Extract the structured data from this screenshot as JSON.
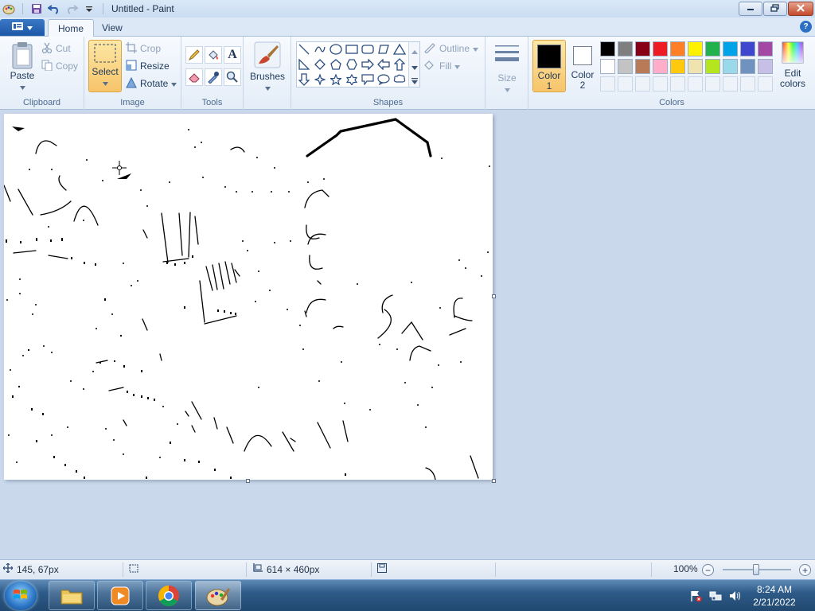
{
  "window": {
    "title": "Untitled - Paint",
    "minimize_icon": "minimize-icon",
    "maximize_icon": "restore-icon",
    "close_icon": "close-icon"
  },
  "qat": {
    "icons": [
      "paint-app-icon",
      "save-icon",
      "undo-icon",
      "redo-icon",
      "customize-dropdown-icon"
    ]
  },
  "tabs": {
    "items": [
      "Home",
      "View"
    ],
    "active": "Home"
  },
  "ribbon": {
    "clipboard": {
      "label": "Clipboard",
      "paste": "Paste",
      "cut": "Cut",
      "copy": "Copy"
    },
    "image": {
      "label": "Image",
      "select": "Select",
      "crop": "Crop",
      "resize": "Resize",
      "rotate": "Rotate"
    },
    "tools": {
      "label": "Tools",
      "items": [
        "pencil-icon",
        "fill-icon",
        "text-icon",
        "eraser-icon",
        "color-picker-icon",
        "magnifier-icon"
      ]
    },
    "brushes": {
      "label": "Brushes"
    },
    "shapes": {
      "label": "Shapes",
      "outline": "Outline",
      "fill": "Fill"
    },
    "size": {
      "label": "Size"
    },
    "colors": {
      "label": "Colors",
      "color1": [
        "Color",
        "1"
      ],
      "color2": [
        "Color",
        "2"
      ],
      "color1_value": "#000000",
      "color2_value": "#ffffff",
      "edit": [
        "Edit",
        "colors"
      ],
      "palette_row1": [
        "#000000",
        "#7f7f7f",
        "#880015",
        "#ed1c24",
        "#ff7f27",
        "#fff200",
        "#22b14c",
        "#00a2e8",
        "#3f48cc",
        "#a349a4"
      ],
      "palette_row2": [
        "#ffffff",
        "#c3c3c3",
        "#b97a57",
        "#ffaec9",
        "#ffc90e",
        "#efe4b0",
        "#b5e61d",
        "#99d9ea",
        "#7092be",
        "#c8bfe7"
      ]
    }
  },
  "status": {
    "cursor_pos": "145, 67px",
    "canvas_size": "614 × 460px",
    "zoom": "100%",
    "zoom_level": 0.5
  },
  "taskbar": {
    "apps": [
      "windows-explorer-icon",
      "media-player-icon",
      "chrome-icon",
      "paint-icon"
    ],
    "time": "8:24 AM",
    "date": "2/21/2022"
  }
}
